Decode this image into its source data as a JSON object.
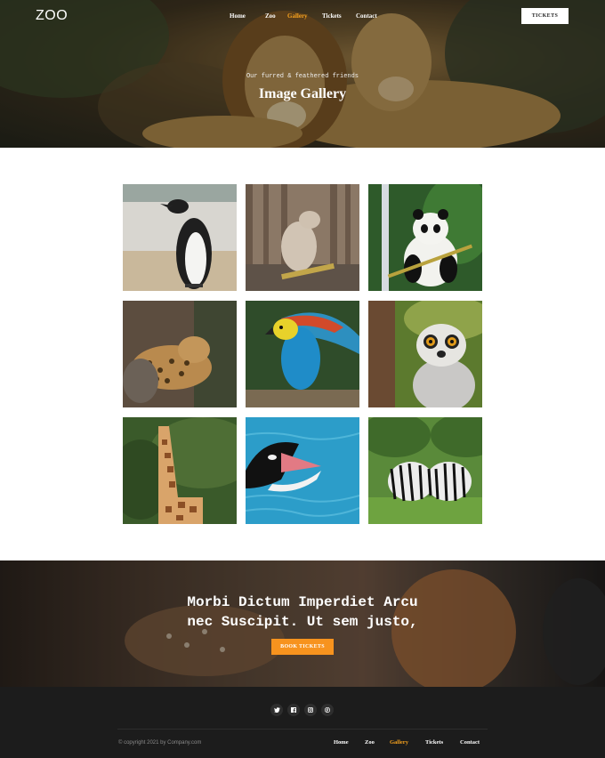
{
  "header": {
    "logo": "ZOO",
    "nav": [
      {
        "label": "Home",
        "active": false
      },
      {
        "label": "Zoo",
        "active": false
      },
      {
        "label": "Gallery",
        "active": true
      },
      {
        "label": "Tickets",
        "active": false
      },
      {
        "label": "Contact",
        "active": false
      }
    ],
    "tickets_button": "TICKETS"
  },
  "hero": {
    "kicker": "Our furred & feathered friends",
    "title": "Image Gallery"
  },
  "gallery": {
    "images": [
      {
        "subject": "penguin"
      },
      {
        "subject": "meerkat"
      },
      {
        "subject": "panda"
      },
      {
        "subject": "leopard"
      },
      {
        "subject": "parrot"
      },
      {
        "subject": "lemur"
      },
      {
        "subject": "giraffe"
      },
      {
        "subject": "orca"
      },
      {
        "subject": "zebras"
      }
    ]
  },
  "cta": {
    "line1": "Morbi Dictum Imperdiet Arcu",
    "line2": "nec Suscipit. Ut sem justo,",
    "button": "BOOK TICKETS"
  },
  "footer": {
    "social": [
      "twitter-icon",
      "facebook-icon",
      "instagram-icon",
      "pinterest-icon"
    ],
    "copyright": "© copyright 2021 by Company.com",
    "nav": [
      {
        "label": "Home",
        "active": false
      },
      {
        "label": "Zoo",
        "active": false
      },
      {
        "label": "Gallery",
        "active": true
      },
      {
        "label": "Tickets",
        "active": false
      },
      {
        "label": "Contact",
        "active": false
      }
    ]
  },
  "colors": {
    "accent": "#f7931e",
    "footer_bg": "#1c1c1c"
  }
}
